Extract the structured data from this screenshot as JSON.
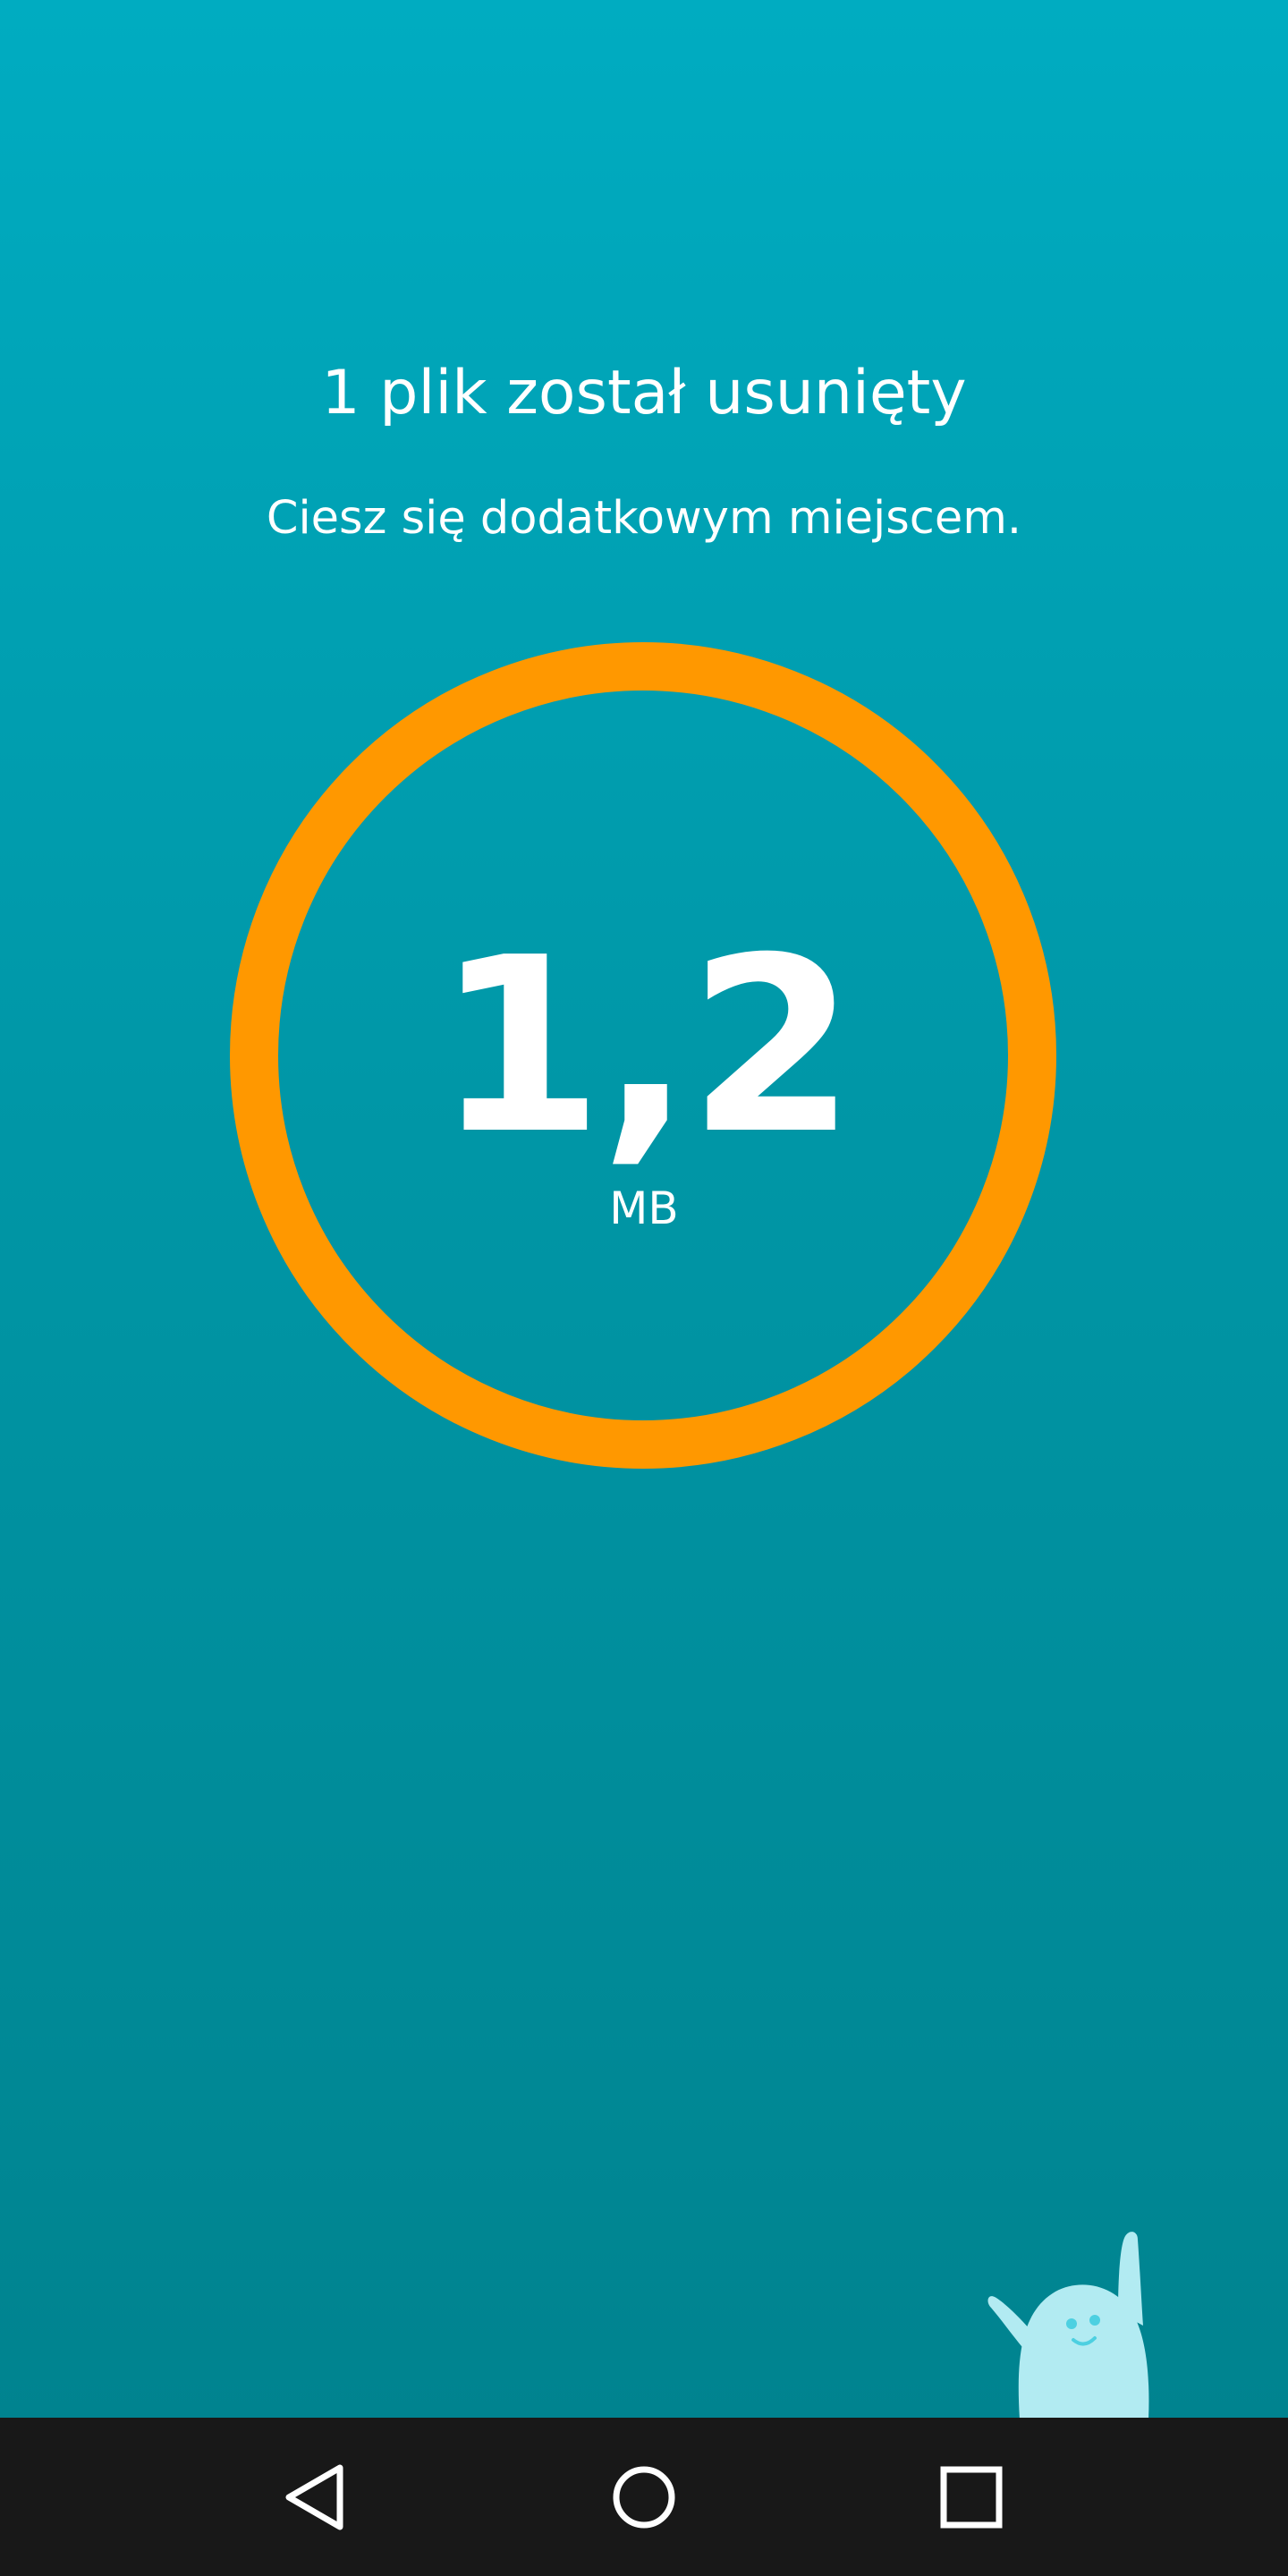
{
  "result": {
    "title": "1 plik został usunięty",
    "subtitle": "Ciesz się dodatkowym miejscem.",
    "freed_amount": "1,2",
    "freed_unit": "MB"
  },
  "colors": {
    "background_top": "#00acc1",
    "background_bottom": "#00838f",
    "ring": "#ff9800",
    "text": "#ffffff",
    "mascot": "#b2ebf2",
    "navbar": "#181818",
    "nav_icons": "#ffffff"
  },
  "icons": {
    "mascot": "celebrating-mascot-icon",
    "back": "back-triangle-icon",
    "home": "home-circle-icon",
    "recents": "recents-square-icon"
  }
}
